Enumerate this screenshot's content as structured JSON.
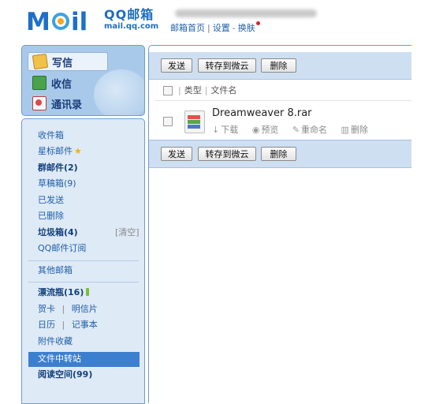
{
  "header": {
    "logo_cn": "QQ邮箱",
    "logo_domain": "mail.qq.com",
    "account_text": "",
    "links": {
      "home": "邮箱首页",
      "settings": "设置",
      "skin": "换肤"
    },
    "sep": "|",
    "dash": "-"
  },
  "left_nav": {
    "write": "写信",
    "inbox": "收信",
    "contacts": "通讯录"
  },
  "folders": {
    "inbox": "收件箱",
    "starred": "星标邮件",
    "group": "群邮件(2)",
    "drafts": "草稿箱(9)",
    "sent": "已发送",
    "deleted": "已删除",
    "junk": "垃圾箱(4)",
    "junk_clear": "[清空]",
    "subscriptions": "QQ邮件订阅",
    "other": "其他邮箱",
    "drift": "漂流瓶(16)",
    "card": "贺卡",
    "postcard": "明信片",
    "calendar": "日历",
    "notes": "记事本",
    "attachments": "附件收藏",
    "transfer": "文件中转站",
    "reading": "阅读空间(99)",
    "pipe": "|"
  },
  "toolbar": {
    "send": "发送",
    "save_cloud": "转存到微云",
    "delete": "删除"
  },
  "list_header": {
    "type": "类型",
    "filename": "文件名",
    "sep": "|"
  },
  "files": [
    {
      "name": "Dreamweaver 8.rar",
      "actions": {
        "download": "下载",
        "preview": "预览",
        "rename": "重命名",
        "delete": "删除"
      }
    }
  ],
  "colors": {
    "accent": "#1f6dbf",
    "toolbar_bg": "#cfdff2",
    "sidebar_bg": "#dfeaf7",
    "active_item": "#3d7fcf"
  }
}
